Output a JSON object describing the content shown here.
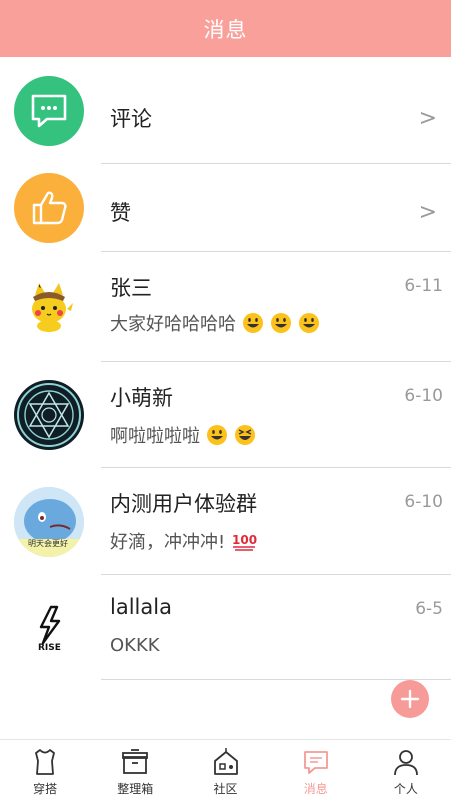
{
  "header": {
    "title": "消息"
  },
  "rows": [
    {
      "title": "评论",
      "arrow": ">"
    },
    {
      "title": "赞",
      "arrow": ">"
    }
  ],
  "chats": [
    {
      "name": "张三",
      "time": "6-11",
      "message": "大家好哈哈哈哈"
    },
    {
      "name": "小萌新",
      "time": "6-10",
      "message": "啊啦啦啦啦"
    },
    {
      "name": "内测用户体验群",
      "time": "6-10",
      "message": "好滴，冲冲冲!",
      "avatar_text": "明天会更好"
    },
    {
      "name": "lallala",
      "time": "6-5",
      "message": "OKKK",
      "avatar_text": "RISE"
    }
  ],
  "tabs": [
    {
      "label": "穿搭",
      "icon": "shirt-icon"
    },
    {
      "label": "整理箱",
      "icon": "box-icon"
    },
    {
      "label": "社区",
      "icon": "house-icon"
    },
    {
      "label": "消息",
      "icon": "message-icon",
      "active": true
    },
    {
      "label": "个人",
      "icon": "person-icon"
    }
  ],
  "colors": {
    "header_bg": "#f9a09b",
    "comment_green": "#34c27e",
    "like_orange": "#fbb03b",
    "active_tab": "#f59a96"
  }
}
